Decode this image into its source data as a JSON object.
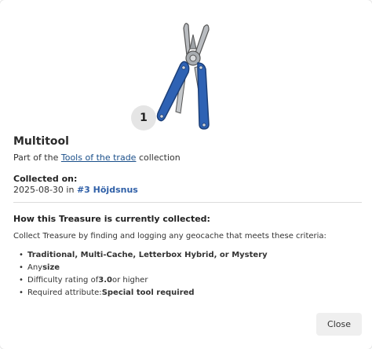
{
  "treasure": {
    "count": "1",
    "title": "Multitool",
    "collection_prefix": "Part of the ",
    "collection_link": "Tools of the trade",
    "collection_suffix": " collection"
  },
  "collected": {
    "label": "Collected on:",
    "date": "2025-08-30",
    "in_word": " in ",
    "cache_name": "#3 Höjdsnus"
  },
  "how": {
    "heading": "How this Treasure is currently collected:",
    "intro": "Collect Treasure by finding and logging any geocache that meets these criteria:",
    "criteria": [
      {
        "bold": "Traditional, Multi-Cache, Letterbox Hybrid, or Mystery",
        "pre": "",
        "post": ""
      },
      {
        "pre": "Any ",
        "bold": "size",
        "post": ""
      },
      {
        "pre": "Difficulty rating of ",
        "bold": "3.0",
        "post": " or higher"
      },
      {
        "pre": "Required attribute: ",
        "bold": "Special tool required",
        "post": ""
      }
    ]
  },
  "buttons": {
    "close": "Close"
  },
  "colors": {
    "tool_blue": "#2e62b4",
    "link": "#1a4f8a",
    "cache_link": "#2f5fa7"
  },
  "icons": {
    "hero": "multitool-icon"
  }
}
